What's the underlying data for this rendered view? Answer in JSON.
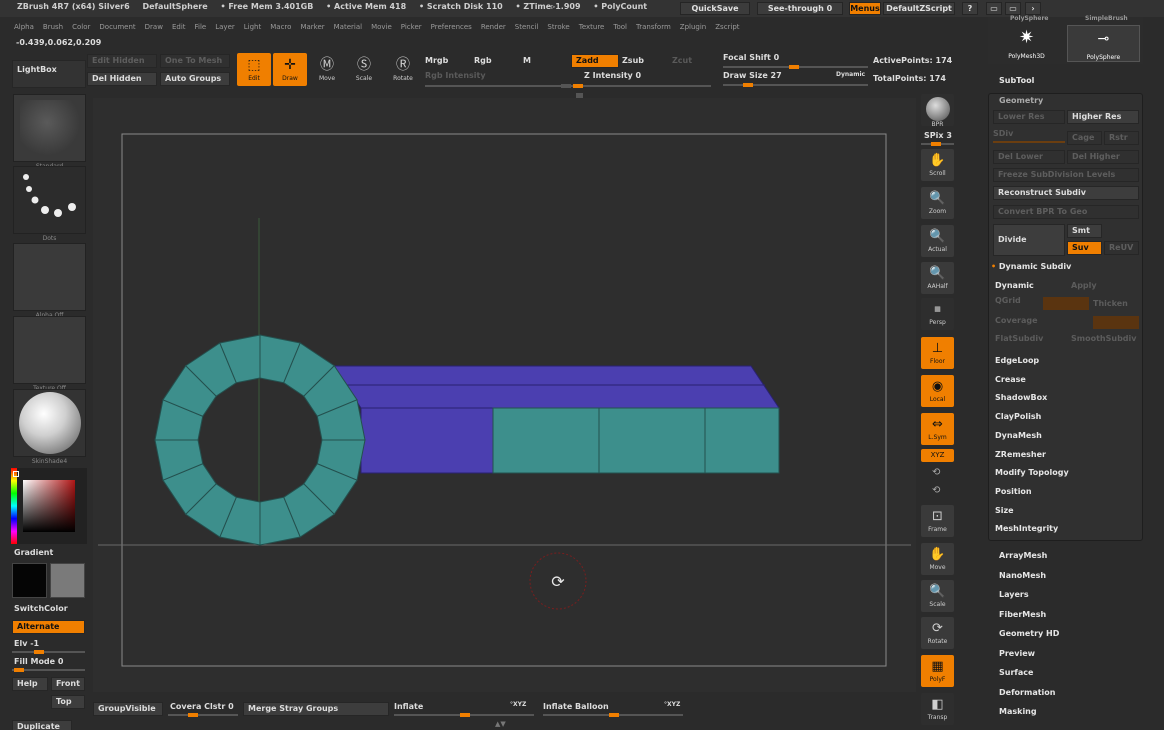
{
  "titlebar": {
    "app": "ZBrush 4R7 (x64) Silver6",
    "doc": "DefaultSphere",
    "free_mem": "• Free Mem 3.401GB",
    "active_mem": "• Active Mem 418",
    "scratch": "• Scratch Disk 110",
    "ztime": "• ZTime▹1.909",
    "polycount": "• PolyCount",
    "quicksave": "QuickSave",
    "see_through": "See-through  0",
    "menus": "Menus",
    "zscript": "DefaultZScript"
  },
  "menubar": [
    "Alpha",
    "Brush",
    "Color",
    "Document",
    "Draw",
    "Edit",
    "File",
    "Layer",
    "Light",
    "Macro",
    "Marker",
    "Material",
    "Movie",
    "Picker",
    "Preferences",
    "Render",
    "Stencil",
    "Stroke",
    "Texture",
    "Tool",
    "Transform",
    "Zplugin",
    "Zscript"
  ],
  "coords": "-0.439,0.062,0.209",
  "shelf": {
    "lightbox": "LightBox",
    "edit_hidden": "Edit Hidden",
    "one_to_mesh": "One To Mesh",
    "del_hidden": "Del Hidden",
    "auto_groups": "Auto Groups",
    "edit": "Edit",
    "draw": "Draw",
    "move": "Move",
    "scale": "Scale",
    "rotate": "Rotate",
    "mrgb": "Mrgb",
    "rgb": "Rgb",
    "m": "M",
    "rgb_intensity": "Rgb Intensity",
    "zadd": "Zadd",
    "zsub": "Zsub",
    "zcut": "Zcut",
    "z_intensity": "Z Intensity 0",
    "focal_shift": "Focal Shift 0",
    "draw_size": "Draw Size 27",
    "dynamic": "Dynamic",
    "active_points": "ActivePoints: 174",
    "total_points": "TotalPoints: 174"
  },
  "left": {
    "thumb_labels": [
      "Standard",
      "Dots",
      "Alpha Off",
      "Texture Off",
      "SkinShade4"
    ],
    "gradient": "Gradient",
    "switch_color": "SwitchColor",
    "alternate": "Alternate",
    "elv": "Elv -1",
    "fill_mode": "Fill Mode 0",
    "help": "Help",
    "front": "Front",
    "top": "Top",
    "duplicate": "Duplicate"
  },
  "bottom": {
    "group_visible": "GroupVisible",
    "covera": "Covera Clstr 0",
    "merge_stray": "Merge Stray Groups",
    "inflate": "Inflate",
    "inflate_xyz": "°XYZ",
    "inflate_balloon": "Inflate Balloon",
    "balloon_xyz": "°XYZ"
  },
  "right_tools": [
    "BPR",
    "SPix 3",
    "Scroll",
    "Zoom",
    "Actual",
    "AAHalf",
    "Persp",
    "Floor",
    "Local",
    "L.Sym",
    "XYZ",
    "Frame",
    "Move",
    "Scale",
    "Rotate",
    "PolyF",
    "Transp"
  ],
  "panel": {
    "polysphere_top": "PolySphere",
    "simplebrush": "SimpleBrush",
    "polymesh3d": "PolyMesh3D",
    "polysphere": "PolySphere",
    "subtool": "SubTool",
    "geometry": "Geometry",
    "lower_res": "Lower Res",
    "higher_res": "Higher Res",
    "sdiv": "SDiv",
    "cage": "Cage",
    "rstr": "Rstr",
    "del_lower": "Del Lower",
    "del_higher": "Del Higher",
    "freeze": "Freeze SubDivision Levels",
    "reconstruct": "Reconstruct Subdiv",
    "convert_bpr": "Convert BPR To Geo",
    "divide": "Divide",
    "smt": "Smt",
    "suv": "Suv",
    "reuv": "ReUV",
    "dynamic_subdiv": "Dynamic Subdiv",
    "dynamic": "Dynamic",
    "apply": "Apply",
    "qgrid": "QGrid",
    "thicken": "Thicken",
    "coverage": "Coverage",
    "flatsubdiv": "FlatSubdiv",
    "smoothsubdiv": "SmoothSubdiv",
    "items": [
      "EdgeLoop",
      "Crease",
      "ShadowBox",
      "ClayPolish",
      "DynaMesh",
      "ZRemesher",
      "Modify Topology",
      "Position",
      "Size",
      "MeshIntegrity"
    ]
  },
  "subtool_menu": [
    "ArrayMesh",
    "NanoMesh",
    "Layers",
    "FiberMesh",
    "Geometry HD",
    "Preview",
    "Surface",
    "Deformation",
    "Masking"
  ],
  "colors": {
    "accent": "#f07f00",
    "mesh_teal": "#3d8f8c",
    "mesh_blue": "#4b3fb0",
    "canvas": "#2e2e2e"
  }
}
